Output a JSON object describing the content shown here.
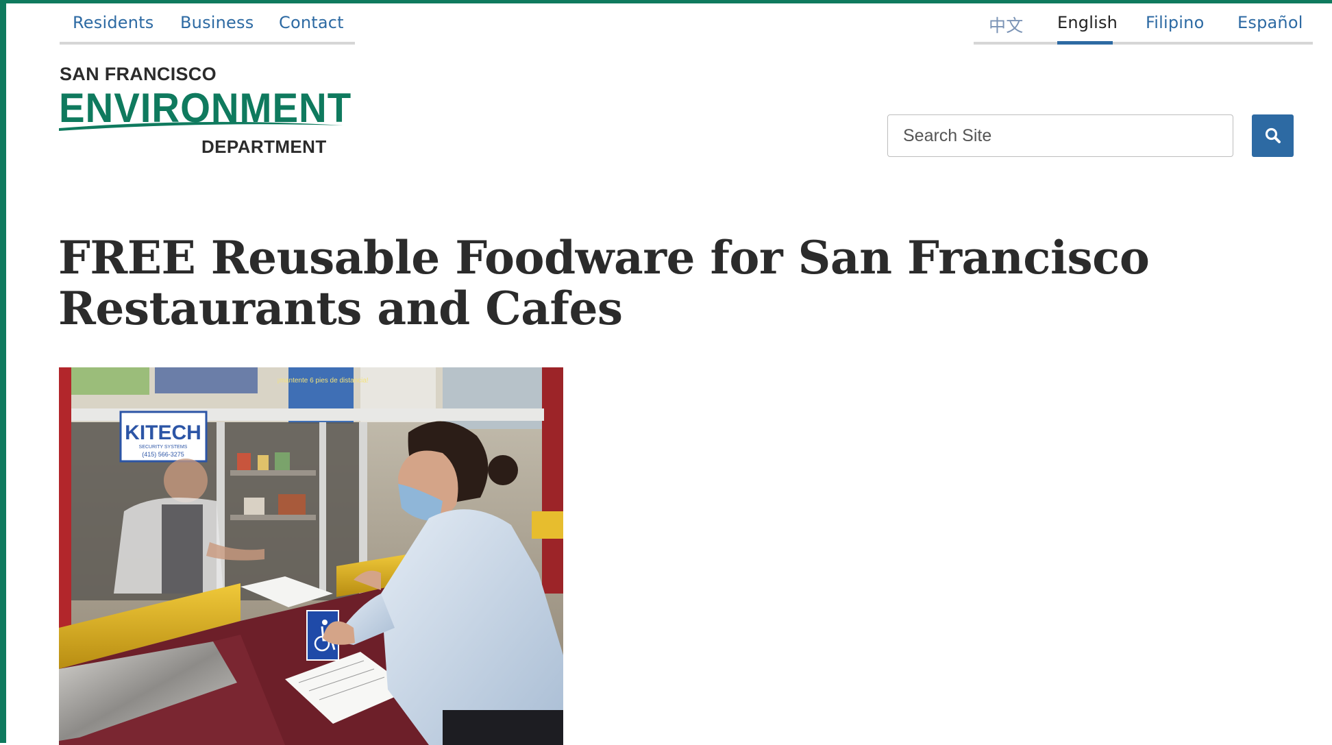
{
  "topnav": {
    "items": [
      {
        "label": "Residents"
      },
      {
        "label": "Business"
      },
      {
        "label": "Contact"
      }
    ]
  },
  "languages": {
    "items": [
      {
        "label": "中文"
      },
      {
        "label": "English"
      },
      {
        "label": "Filipino"
      },
      {
        "label": "Español"
      }
    ],
    "active": "English"
  },
  "logo": {
    "line1": "SAN FRANCISCO",
    "line2": "ENVIRONMENT",
    "line3": "DEPARTMENT"
  },
  "search": {
    "placeholder": "Search Site",
    "value": "",
    "button_icon": "search-icon"
  },
  "page": {
    "title": "FREE Reusable Foodware for San Francisco Restaurants and Cafes"
  },
  "hero_image": {
    "sign_text": "KITECH",
    "sign_subtext": "SECURITY SYSTEMS",
    "sign_phone": "(415) 566-3275",
    "poster_text": "¡mantente 6 pies de distancia!"
  },
  "colors": {
    "brand_green": "#0f7a5e",
    "link_blue": "#2d6aa3",
    "title_text": "#2b2b2b"
  }
}
